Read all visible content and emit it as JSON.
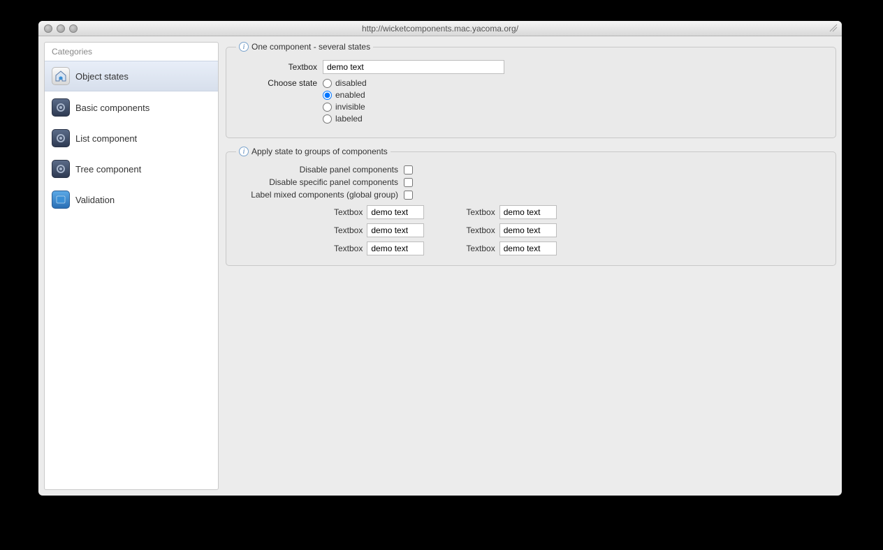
{
  "window": {
    "title": "http://wicketcomponents.mac.yacoma.org/"
  },
  "sidebar": {
    "title": "Categories",
    "items": [
      {
        "label": "Object states",
        "selected": true,
        "icon": "home"
      },
      {
        "label": "Basic components",
        "selected": false,
        "icon": "comp"
      },
      {
        "label": "List component",
        "selected": false,
        "icon": "comp"
      },
      {
        "label": "Tree component",
        "selected": false,
        "icon": "comp"
      },
      {
        "label": "Validation",
        "selected": false,
        "icon": "val"
      }
    ]
  },
  "group1": {
    "legend": "One component - several states",
    "textbox_label": "Textbox",
    "textbox_value": "demo text",
    "choose_label": "Choose state",
    "radios": [
      {
        "label": "disabled",
        "checked": false
      },
      {
        "label": "enabled",
        "checked": true
      },
      {
        "label": "invisible",
        "checked": false
      },
      {
        "label": "labeled",
        "checked": false
      }
    ]
  },
  "group2": {
    "legend": "Apply state to groups of components",
    "checks": [
      {
        "label": "Disable panel components",
        "checked": false
      },
      {
        "label": "Disable specific panel components",
        "checked": false
      },
      {
        "label": "Label mixed components (global group)",
        "checked": false
      }
    ],
    "grid_label": "Textbox",
    "grid_value": "demo text",
    "left_count": 3,
    "right_count": 3
  }
}
